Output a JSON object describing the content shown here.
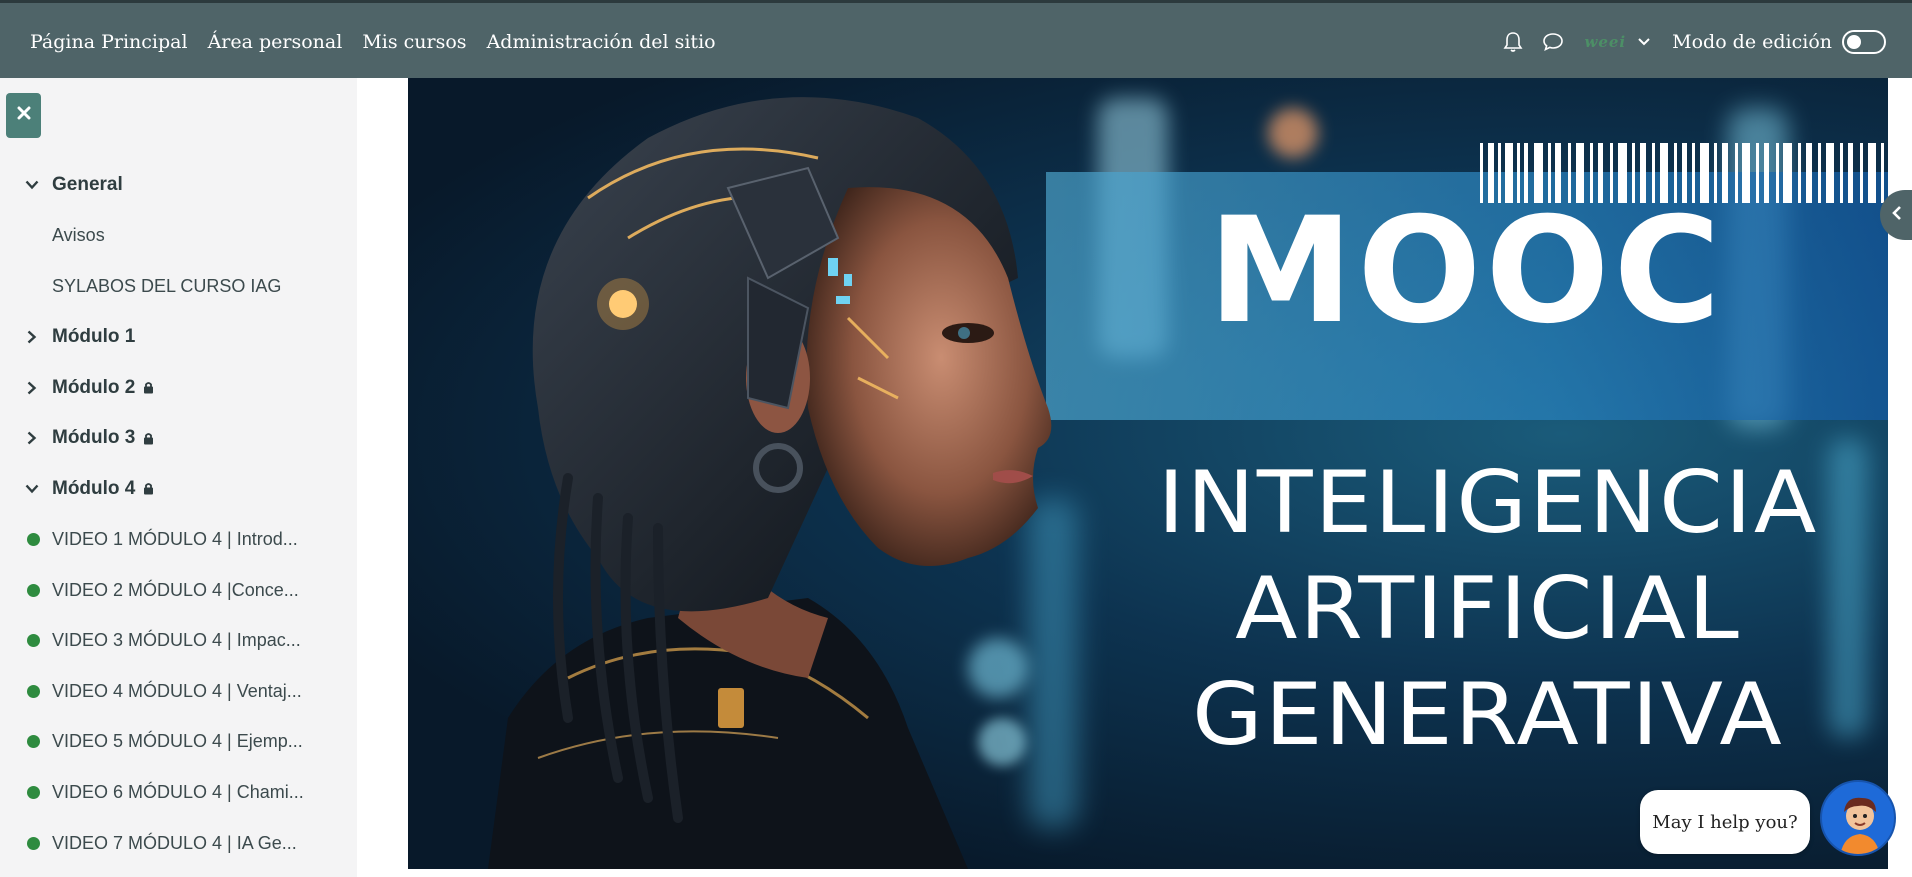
{
  "navbar": {
    "links": [
      "Página Principal",
      "Área personal",
      "Mis cursos",
      "Administración del sitio"
    ],
    "icons": [
      "bell-icon",
      "chat-icon"
    ],
    "avatar_text": "weei",
    "edit_mode_label": "Modo de edición",
    "edit_mode_on": false
  },
  "sidebar": {
    "close_icon": "close-icon",
    "items": [
      {
        "type": "section",
        "label": "General",
        "expanded": true,
        "locked": false
      },
      {
        "type": "item",
        "label": "Avisos"
      },
      {
        "type": "item",
        "label": "SYLABOS DEL CURSO IAG"
      },
      {
        "type": "section",
        "label": "Módulo 1",
        "expanded": false,
        "locked": false
      },
      {
        "type": "section",
        "label": "Módulo 2",
        "expanded": false,
        "locked": true
      },
      {
        "type": "section",
        "label": "Módulo 3",
        "expanded": false,
        "locked": true
      },
      {
        "type": "section",
        "label": "Módulo 4",
        "expanded": true,
        "locked": true
      },
      {
        "type": "activity",
        "label": "VIDEO 1 MÓDULO 4 | Introd...",
        "completed": true
      },
      {
        "type": "activity",
        "label": "VIDEO 2 MÓDULO 4 |Conce...",
        "completed": true
      },
      {
        "type": "activity",
        "label": "VIDEO 3 MÓDULO 4 | Impac...",
        "completed": true
      },
      {
        "type": "activity",
        "label": "VIDEO 4 MÓDULO 4 | Ventaj...",
        "completed": true
      },
      {
        "type": "activity",
        "label": "VIDEO 5 MÓDULO 4 | Ejemp...",
        "completed": true
      },
      {
        "type": "activity",
        "label": "VIDEO 6 MÓDULO 4 | Chami...",
        "completed": true
      },
      {
        "type": "activity",
        "label": "VIDEO 7 MÓDULO 4 | IA Ge...",
        "completed": true
      }
    ]
  },
  "banner": {
    "title": "MOOC",
    "subtitle_lines": [
      "INTELIGENCIA",
      "ARTIFICIAL",
      "GENERATIVA"
    ]
  },
  "chat": {
    "prompt": "May I help you?"
  },
  "colors": {
    "navbar": "#4f6468",
    "sidebar_bg": "#f4f4f5",
    "close_button": "#4c8079",
    "completion_dot": "#2e8b3f",
    "chat_avatar": "#1e6ad8"
  }
}
